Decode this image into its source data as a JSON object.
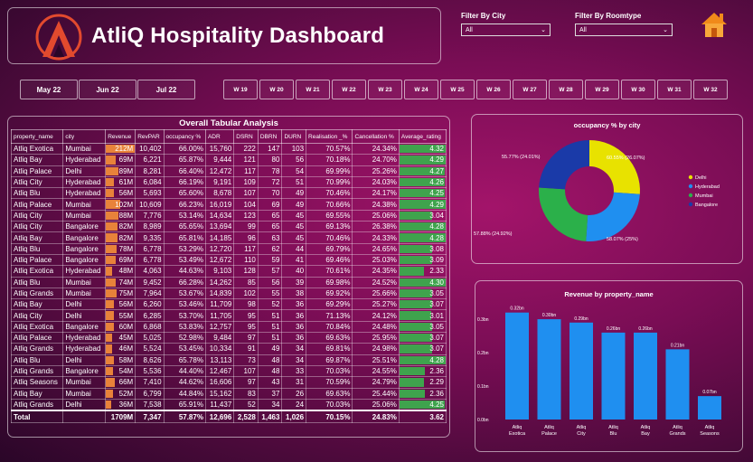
{
  "header": {
    "title": "AtliQ Hospitality Dashboard"
  },
  "filters": {
    "city_label": "Filter By City",
    "city_value": "All",
    "roomtype_label": "Filter By Roomtype",
    "roomtype_value": "All"
  },
  "months": [
    "May 22",
    "Jun 22",
    "Jul 22"
  ],
  "weeks": [
    "W 19",
    "W 20",
    "W 21",
    "W 22",
    "W 23",
    "W 24",
    "W 25",
    "W 26",
    "W 27",
    "W 28",
    "W 29",
    "W 30",
    "W 31",
    "W 32"
  ],
  "table": {
    "title": "Overall Tabular Analysis",
    "columns": [
      "property_name",
      "city",
      "Revenue",
      "RevPAR",
      "occupancy %",
      "ADR",
      "DSRN",
      "DBRN",
      "DURN",
      "Realisation _%",
      "Cancellation %",
      "Average_rating"
    ],
    "rows": [
      [
        "Atliq Exotica",
        "Mumbai",
        "212M",
        "10,402",
        "66.00%",
        "15,760",
        "222",
        "147",
        "103",
        "70.57%",
        "24.34%",
        "4.32"
      ],
      [
        "Atliq Bay",
        "Hyderabad",
        "69M",
        "6,221",
        "65.87%",
        "9,444",
        "121",
        "80",
        "56",
        "70.18%",
        "24.70%",
        "4.29"
      ],
      [
        "Atliq Palace",
        "Delhi",
        "89M",
        "8,281",
        "66.40%",
        "12,472",
        "117",
        "78",
        "54",
        "69.99%",
        "25.26%",
        "4.27"
      ],
      [
        "Atliq City",
        "Hyderabad",
        "61M",
        "6,084",
        "66.19%",
        "9,191",
        "109",
        "72",
        "51",
        "70.99%",
        "24.03%",
        "4.26"
      ],
      [
        "Atliq Blu",
        "Hyderabad",
        "56M",
        "5,693",
        "65.60%",
        "8,678",
        "107",
        "70",
        "49",
        "70.46%",
        "24.17%",
        "4.25"
      ],
      [
        "Atliq Palace",
        "Mumbai",
        "102M",
        "10,609",
        "66.23%",
        "16,019",
        "104",
        "69",
        "49",
        "70.66%",
        "24.38%",
        "4.29"
      ],
      [
        "Atliq City",
        "Mumbai",
        "88M",
        "7,776",
        "53.14%",
        "14,634",
        "123",
        "65",
        "45",
        "69.55%",
        "25.06%",
        "3.04"
      ],
      [
        "Atliq City",
        "Bangalore",
        "82M",
        "8,989",
        "65.65%",
        "13,694",
        "99",
        "65",
        "45",
        "69.13%",
        "26.38%",
        "4.28"
      ],
      [
        "Atliq Bay",
        "Bangalore",
        "82M",
        "9,335",
        "65.81%",
        "14,185",
        "96",
        "63",
        "45",
        "70.46%",
        "24.33%",
        "4.28"
      ],
      [
        "Atliq Blu",
        "Bangalore",
        "78M",
        "6,778",
        "53.29%",
        "12,720",
        "117",
        "62",
        "44",
        "69.79%",
        "24.65%",
        "3.08"
      ],
      [
        "Atliq Palace",
        "Bangalore",
        "69M",
        "6,778",
        "53.49%",
        "12,672",
        "110",
        "59",
        "41",
        "69.46%",
        "25.03%",
        "3.09"
      ],
      [
        "Atliq Exotica",
        "Hyderabad",
        "48M",
        "4,063",
        "44.63%",
        "9,103",
        "128",
        "57",
        "40",
        "70.61%",
        "24.35%",
        "2.33"
      ],
      [
        "Atliq Blu",
        "Mumbai",
        "74M",
        "9,452",
        "66.28%",
        "14,262",
        "85",
        "56",
        "39",
        "69.98%",
        "24.52%",
        "4.30"
      ],
      [
        "Atliq Grands",
        "Mumbai",
        "75M",
        "7,964",
        "53.67%",
        "14,839",
        "102",
        "55",
        "38",
        "69.92%",
        "25.66%",
        "3.05"
      ],
      [
        "Atliq Bay",
        "Delhi",
        "56M",
        "6,260",
        "53.46%",
        "11,709",
        "98",
        "52",
        "36",
        "69.29%",
        "25.27%",
        "3.07"
      ],
      [
        "Atliq City",
        "Delhi",
        "55M",
        "6,285",
        "53.70%",
        "11,705",
        "95",
        "51",
        "36",
        "71.13%",
        "24.12%",
        "3.01"
      ],
      [
        "Atliq Exotica",
        "Bangalore",
        "60M",
        "6,868",
        "53.83%",
        "12,757",
        "95",
        "51",
        "36",
        "70.84%",
        "24.48%",
        "3.05"
      ],
      [
        "Atliq Palace",
        "Hyderabad",
        "45M",
        "5,025",
        "52.98%",
        "9,484",
        "97",
        "51",
        "36",
        "69.63%",
        "25.95%",
        "3.07"
      ],
      [
        "Atliq Grands",
        "Hyderabad",
        "46M",
        "5,524",
        "53.45%",
        "10,334",
        "91",
        "49",
        "34",
        "69.81%",
        "24.98%",
        "3.07"
      ],
      [
        "Atliq Blu",
        "Delhi",
        "58M",
        "8,626",
        "65.78%",
        "13,113",
        "73",
        "48",
        "34",
        "69.87%",
        "25.51%",
        "4.28"
      ],
      [
        "Atliq Grands",
        "Bangalore",
        "54M",
        "5,536",
        "44.40%",
        "12,467",
        "107",
        "48",
        "33",
        "70.03%",
        "24.55%",
        "2.36"
      ],
      [
        "Atliq Seasons",
        "Mumbai",
        "66M",
        "7,410",
        "44.62%",
        "16,606",
        "97",
        "43",
        "31",
        "70.59%",
        "24.79%",
        "2.29"
      ],
      [
        "Atliq Bay",
        "Mumbai",
        "52M",
        "6,799",
        "44.84%",
        "15,162",
        "83",
        "37",
        "26",
        "69.63%",
        "25.44%",
        "2.36"
      ],
      [
        "Atliq Grands",
        "Delhi",
        "36M",
        "7,538",
        "65.91%",
        "11,437",
        "52",
        "34",
        "24",
        "70.03%",
        "25.06%",
        "4.25"
      ]
    ],
    "total": [
      "Total",
      "",
      "1709M",
      "7,347",
      "57.87%",
      "12,696",
      "2,528",
      "1,463",
      "1,026",
      "70.15%",
      "24.83%",
      "3.62"
    ]
  },
  "chart_data": [
    {
      "type": "pie",
      "title": "occupancy % by city",
      "categories": [
        "Delhi",
        "Hyderabad",
        "Mumbai",
        "Bangalore"
      ],
      "values": [
        60.55,
        58.07,
        57.88,
        55.77
      ],
      "data_labels": [
        "60.55% (26.07%)",
        "58.07% (25%)",
        "57.88% (24.92%)",
        "55.77% (24.01%)"
      ],
      "colors": [
        "#e8e200",
        "#1f8ff0",
        "#2bb04a",
        "#1a3aa8"
      ],
      "legend": "right"
    },
    {
      "type": "bar",
      "title": "Revenue by property_name",
      "categories": [
        "Atliq Exotica",
        "Atliq Palace",
        "Atliq City",
        "Atliq Blu",
        "Atliq Bay",
        "Atliq Grands",
        "Atliq Seasons"
      ],
      "values": [
        0.32,
        0.3,
        0.29,
        0.26,
        0.26,
        0.21,
        0.07
      ],
      "data_labels": [
        "0.32bn",
        "0.30bn",
        "0.29bn",
        "0.26bn",
        "0.26bn",
        "0.21bn",
        "0.07bn"
      ],
      "yticks": [
        "0.3bn",
        "0.2bn",
        "0.1bn",
        "0.0bn"
      ],
      "ylim": [
        0,
        0.33
      ],
      "color": "#1f8ff0"
    }
  ]
}
